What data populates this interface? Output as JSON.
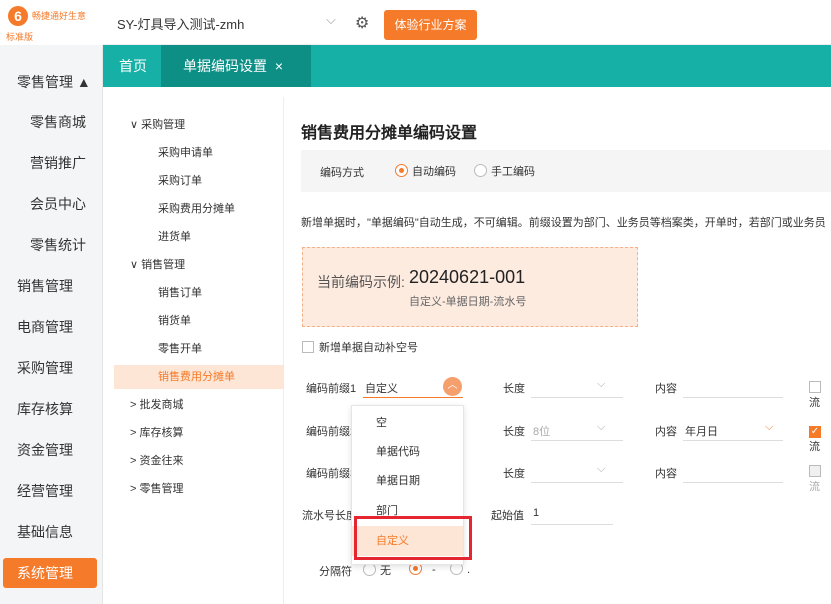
{
  "app": {
    "name": "畅捷通好生意",
    "edition": "标准版"
  },
  "topbar": {
    "account": "SY-灯具导入测试-zmh",
    "experience_button": "体验行业方案"
  },
  "sidebar": {
    "items": [
      "零售管理 ▲",
      "零售商城",
      "营销推广",
      "会员中心",
      "零售统计",
      "销售管理",
      "电商管理",
      "采购管理",
      "库存核算",
      "资金管理",
      "经营管理",
      "基础信息",
      "系统管理"
    ]
  },
  "tabs": {
    "home": "首页",
    "active": "单据编码设置",
    "close": "×"
  },
  "tree": {
    "purchase": "采购管理",
    "purchase_items": [
      "采购申请单",
      "采购订单",
      "采购费用分摊单",
      "进货单"
    ],
    "sales": "销售管理",
    "sales_items": [
      "销售订单",
      "销货单",
      "零售开单",
      "销售费用分摊单"
    ],
    "collapsed": [
      "批发商城",
      "库存核算",
      "资金往来",
      "零售管理"
    ]
  },
  "main": {
    "title": "销售费用分摊单编码设置",
    "method_label": "编码方式",
    "method_auto": "自动编码",
    "method_manual": "手工编码",
    "note": "新增单据时，\"单据编码\"自动生成，不可编辑。前缀设置为部门、业务员等档案类，开单时，若部门或业务员",
    "sample_label": "当前编码示例:",
    "sample_value": "20240621-001",
    "sample_format": "自定义-单据日期-流水号",
    "autofill_label": "新增单据自动补空号",
    "prefix1_label": "编码前缀1",
    "prefix1_value": "自定义",
    "prefix2_label": "编码前缀2",
    "prefix3_label": "编码前缀3",
    "length_label": "长度",
    "length2_placeholder": "8位",
    "content_label": "内容",
    "content2_value": "年月日",
    "serial_label": "流水号长度",
    "start_label": "起始值",
    "start_value": "1",
    "separator_label": "分隔符",
    "sep_none": "无",
    "sep_dash": "-",
    "sep_dot": ".",
    "trunc": "流"
  },
  "dropdown": {
    "options": [
      "空",
      "单据代码",
      "单据日期",
      "部门",
      "自定义"
    ],
    "selected": "自定义"
  },
  "colors": {
    "accent": "#f57a2a",
    "teal": "#16b0a6",
    "highlight": "#e52630"
  }
}
